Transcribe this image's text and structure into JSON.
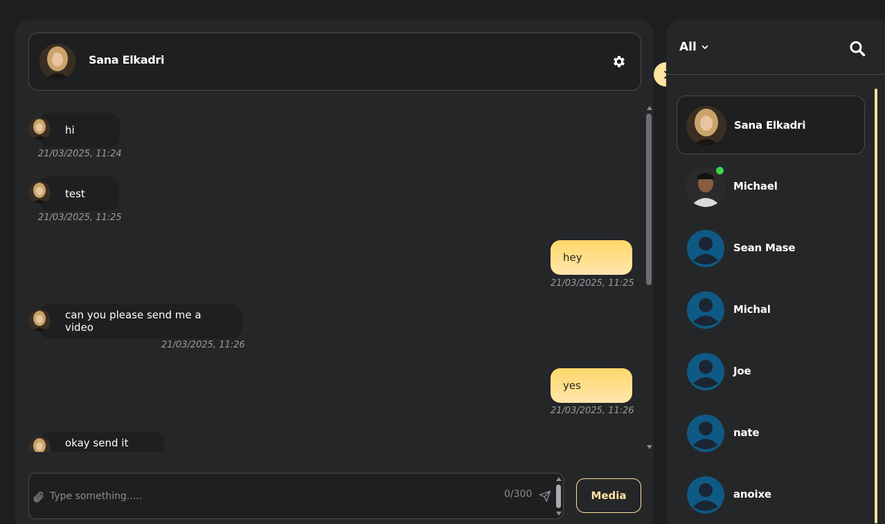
{
  "chat": {
    "contact_name": "Sana Elkadri",
    "messages": [
      {
        "text": "hi",
        "time": "21/03/2025, 11:24"
      },
      {
        "text": "test",
        "time": "21/03/2025, 11:25"
      },
      {
        "text": "hey",
        "time": "21/03/2025, 11:25"
      },
      {
        "text": "can you please send me a video",
        "time": "21/03/2025, 11:26"
      },
      {
        "text": "yes",
        "time": "21/03/2025, 11:26"
      },
      {
        "text": "okay send it now"
      }
    ]
  },
  "composer": {
    "placeholder": "Type something.....",
    "counter": "0/300",
    "media_label": "Media"
  },
  "sidebar": {
    "filter_label": "All",
    "contacts": [
      {
        "name": "Sana Elkadri",
        "online": false
      },
      {
        "name": "Michael",
        "online": true
      },
      {
        "name": "Sean Mase",
        "online": false
      },
      {
        "name": "Michal",
        "online": false
      },
      {
        "name": "Joe",
        "online": false
      },
      {
        "name": "nate",
        "online": false
      },
      {
        "name": "anoixe",
        "online": false
      }
    ]
  },
  "colors": {
    "accent": "#ffe3a0",
    "outgoing_bubble": "#ffd76a",
    "panel": "#252628",
    "background": "#1d1e20",
    "online": "#3bd44a",
    "default_avatar": "#0f5a85"
  },
  "icons": [
    "gear-icon",
    "paperclip-icon",
    "send-icon",
    "chevron-right-icon",
    "chevron-down-icon",
    "search-icon",
    "user-icon"
  ]
}
